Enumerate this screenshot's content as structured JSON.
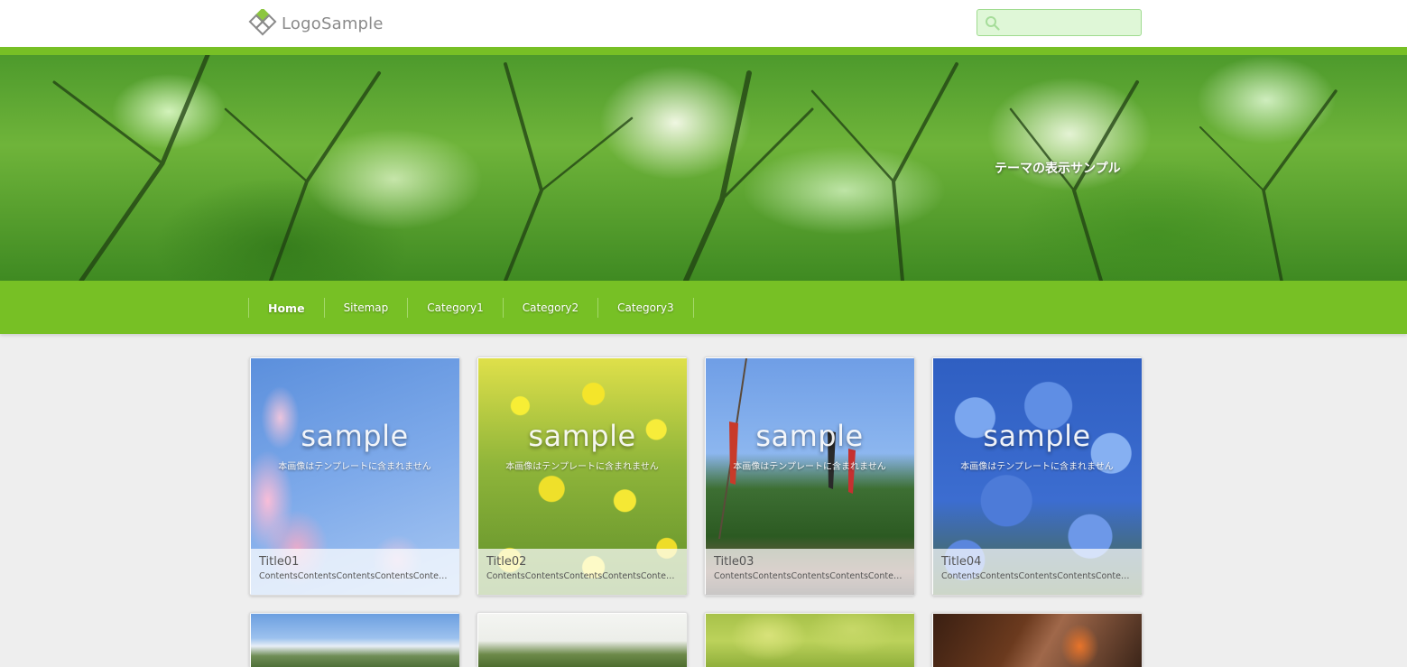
{
  "header": {
    "logo_text": "LogoSample",
    "search": {
      "placeholder": "",
      "value": ""
    }
  },
  "hero": {
    "caption": "テーマの表示サンプル"
  },
  "nav": {
    "items": [
      {
        "label": "Home",
        "active": true
      },
      {
        "label": "Sitemap",
        "active": false
      },
      {
        "label": "Category1",
        "active": false
      },
      {
        "label": "Category2",
        "active": false
      },
      {
        "label": "Category3",
        "active": false
      }
    ]
  },
  "cards": [
    {
      "title": "Title01",
      "excerpt": "ContentsContentsContentsContentsConten…",
      "overlay": "sample",
      "note": "本画像はテンプレートに含まれません"
    },
    {
      "title": "Title02",
      "excerpt": "ContentsContentsContentsContentsConten…",
      "overlay": "sample",
      "note": "本画像はテンプレートに含まれません"
    },
    {
      "title": "Title03",
      "excerpt": "ContentsContentsContentsContentsConten…",
      "overlay": "sample",
      "note": "本画像はテンプレートに含まれません"
    },
    {
      "title": "Title04",
      "excerpt": "ContentsContentsContentsContentsConten…",
      "overlay": "sample",
      "note": "本画像はテンプレートに含まれません"
    }
  ],
  "colors": {
    "brand_green": "#77c025",
    "search_bg": "#dff7d7",
    "page_bg": "#eeeeee"
  },
  "icons": {
    "logo": "diamond-logo-icon",
    "search": "search-icon"
  }
}
